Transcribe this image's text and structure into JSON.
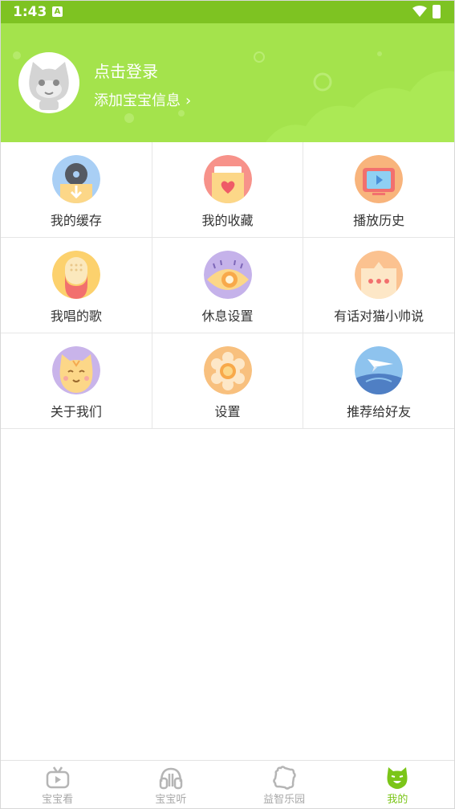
{
  "status_bar": {
    "time": "1:43",
    "notification": "A"
  },
  "header": {
    "login_title": "点击登录",
    "add_info": "添加宝宝信息",
    "chevron": "›"
  },
  "menu": [
    {
      "label": "我的缓存",
      "icon": "download-icon",
      "bg": "#a9cff5"
    },
    {
      "label": "我的收藏",
      "icon": "favorite-heart-icon",
      "bg": "#f7928a"
    },
    {
      "label": "播放历史",
      "icon": "tv-history-icon",
      "bg": "#f8b47c"
    },
    {
      "label": "我唱的歌",
      "icon": "microphone-icon",
      "bg": "#fcd16d"
    },
    {
      "label": "休息设置",
      "icon": "eye-rest-icon",
      "bg": "#c5b2ea"
    },
    {
      "label": "有话对猫小帅说",
      "icon": "chat-bubble-icon",
      "bg": "#fbc290"
    },
    {
      "label": "关于我们",
      "icon": "cat-face-icon",
      "bg": "#c9b4ea"
    },
    {
      "label": "设置",
      "icon": "settings-flower-icon",
      "bg": "#f8c07e"
    },
    {
      "label": "推荐给好友",
      "icon": "paper-plane-icon",
      "bg": "#8ec3ee"
    }
  ],
  "tabs": [
    {
      "label": "宝宝看",
      "icon": "tv-icon",
      "active": false
    },
    {
      "label": "宝宝听",
      "icon": "headphones-icon",
      "active": false
    },
    {
      "label": "益智乐园",
      "icon": "puzzle-icon",
      "active": false
    },
    {
      "label": "我的",
      "icon": "cat-profile-icon",
      "active": true
    }
  ],
  "colors": {
    "status_bar": "#7ec322",
    "header": "#a4e34c",
    "active_tab": "#7bc518",
    "inactive_tab": "#a9a9a9"
  }
}
